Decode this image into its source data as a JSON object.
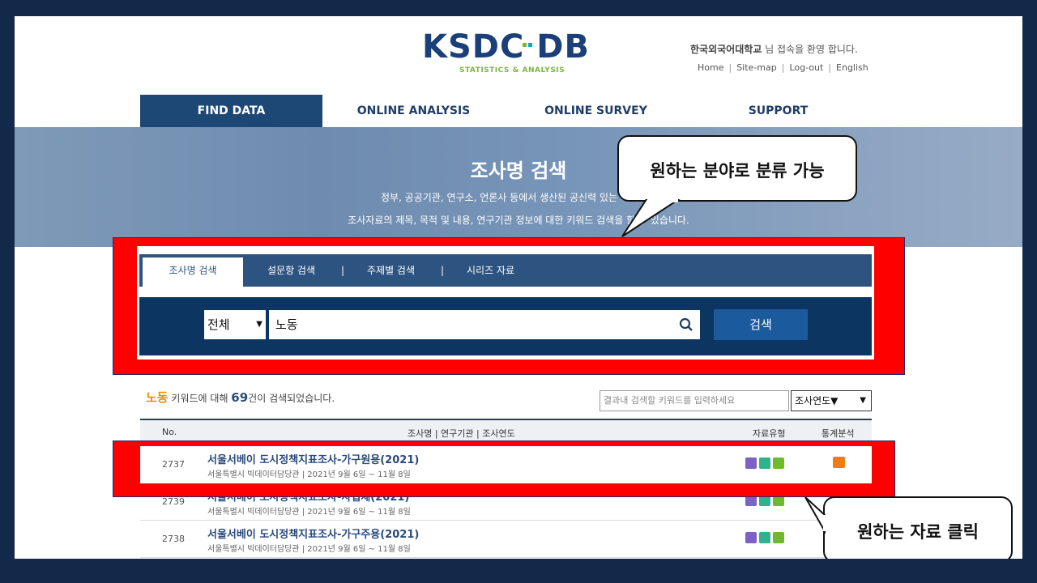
{
  "logo": {
    "main": "KSDC DB",
    "sub": "STATISTICS & ANALYSIS"
  },
  "header": {
    "welcome_org": "한국외국어대학교",
    "welcome_text": " 님 접속을 환영 합니다.",
    "links": [
      "Home",
      "Site-map",
      "Log-out",
      "English"
    ]
  },
  "nav": [
    "FIND DATA",
    "ONLINE ANALYSIS",
    "ONLINE SURVEY",
    "SUPPORT"
  ],
  "hero": {
    "title": "조사명 검색",
    "line1": "정부, 공공기관, 연구소, 언론사 등에서 생산된 공신력 있는 데이터를",
    "line2": "조사자료의 제목, 목적 및 내용, 연구기관 정보에 대한 키워드 검색을 할 수 있습니다."
  },
  "search": {
    "tabs": [
      "조사명 검색",
      "설문항 검색",
      "주제별 검색",
      "시리즈 자료"
    ],
    "scope": "전체",
    "query": "노동",
    "button": "검색"
  },
  "results": {
    "keyword": "노동",
    "text1": " 키워드에 대해 ",
    "count": "69",
    "text2": "건이 검색되었습니다.",
    "filter_placeholder": "결과내 검색할 키워드를 입력하세요",
    "sort": "조사연도▼"
  },
  "table_header": {
    "no": "No.",
    "info": "조사명 | 연구기관 | 조사연도",
    "type": "자료유형",
    "stat": "통계분석"
  },
  "rows": [
    {
      "no": "2737",
      "title": "서울서베이 도시정책지표조사-가구원용(2021)",
      "meta": "서울특별시 빅데이터담당관  |  2021년 9월 6일 ~ 11월 8일"
    },
    {
      "no": "2739",
      "title": "서울서베이 도시정책지표조사-사업체(2021)",
      "meta": "서울특별시 빅데이터담당관  |  2021년 9월 6일 ~ 11월 8일"
    },
    {
      "no": "2738",
      "title": "서울서베이 도시정책지표조사-가구주용(2021)",
      "meta": "서울특별시 빅데이터담당관  |  2021년 9월 6일 ~ 11월 8일"
    }
  ],
  "callouts": {
    "top": "원하는 분야로 분류 가능",
    "bottom": "원하는 자료 클릭"
  },
  "colors": {
    "nav_active": "#1d4774",
    "highlight": "#ff0000",
    "accent": "#f08c00"
  }
}
